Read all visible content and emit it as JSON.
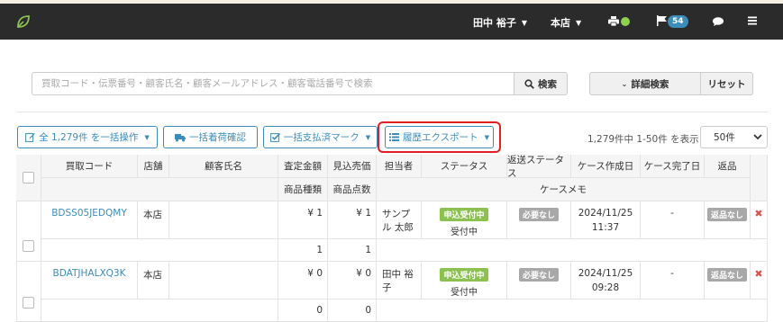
{
  "navbar": {
    "user_name": "田中 裕子",
    "store": "本店",
    "notification_count": "54",
    "status_color": "#8fd14f",
    "icons": [
      "leaf-logo-icon",
      "printer-icon",
      "flag-icon",
      "chat-icon",
      "hamburger-menu-icon"
    ]
  },
  "search": {
    "placeholder": "買取コード・伝票番号・顧客氏名・顧客メールアドレス・顧客電話番号で検索",
    "value": "",
    "search_button": "検索",
    "advanced_button": "詳細検索",
    "reset_button": "リセット"
  },
  "actions": {
    "bulk_operation": "全 1,279件 を一括操作",
    "bulk_arrival": "一括着荷確認",
    "bulk_payment": "一括支払済マーク",
    "history_export": "履歴エクスポート",
    "page_info": "1,279件中 1-50件 を表示",
    "per_page": "50件"
  },
  "table": {
    "headers": {
      "code": "買取コード",
      "store": "店舗",
      "customer": "顧客氏名",
      "assess_amount": "査定金額",
      "sale_price": "見込売価",
      "staff": "担当者",
      "status": "ステータス",
      "return_status": "返送ステータス",
      "created": "ケース作成日",
      "completed": "ケース完了日",
      "return": "返品",
      "item_types": "商品種類",
      "item_count": "商品点数",
      "memo": "ケースメモ"
    },
    "rows": [
      {
        "code": "BDSS05JEDQMY",
        "store": "本店",
        "customer": "",
        "assess_amount": "¥ 1",
        "sale_price": "¥ 1",
        "staff": "サンプル 太郎",
        "status_label": "申込受付中",
        "status_text": "受付中",
        "return_status": "必要なし",
        "created_date": "2024/11/25",
        "created_time": "11:37",
        "completed": "-",
        "return_label": "返品なし",
        "item_types": "1",
        "item_count": "1",
        "memo": ""
      },
      {
        "code": "BDATJHALXQ3K",
        "store": "本店",
        "customer": "",
        "assess_amount": "¥ 0",
        "sale_price": "¥ 0",
        "staff": "田中 裕子",
        "status_label": "申込受付中",
        "status_text": "受付中",
        "return_status": "必要なし",
        "created_date": "2024/11/25",
        "created_time": "09:28",
        "completed": "-",
        "return_label": "返品なし",
        "item_types": "0",
        "item_count": "0",
        "memo": ""
      }
    ]
  },
  "colors": {
    "navbar": "#2b2b2b",
    "accent": "#3c8dbc",
    "status_green": "#8cc152",
    "label_gray": "#a8a8a8",
    "delete_red": "#d9534f",
    "highlight_red": "#e02020"
  }
}
